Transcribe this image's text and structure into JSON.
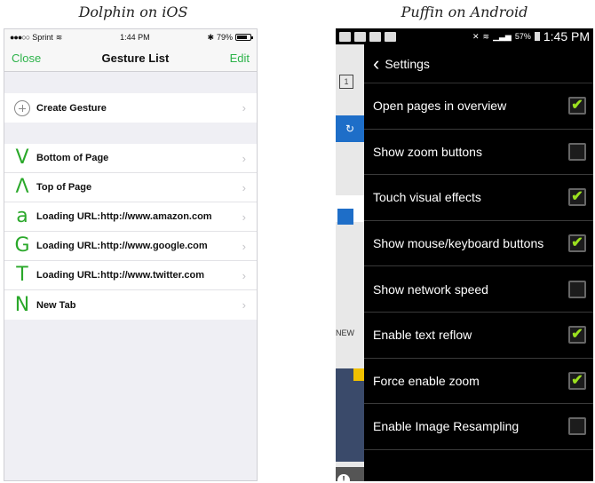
{
  "captions": {
    "left": "Dolphin on iOS",
    "right": "Puffin on Android"
  },
  "ios": {
    "status": {
      "carrier": "Sprint",
      "time": "1:44 PM",
      "battery": "79%",
      "battery_level": 0.79
    },
    "nav": {
      "left": "Close",
      "title": "Gesture List",
      "right": "Edit"
    },
    "create": {
      "label": "Create Gesture"
    },
    "gestures": [
      {
        "glyph": "V",
        "label": "Bottom of Page"
      },
      {
        "glyph": "Λ",
        "label": "Top of Page"
      },
      {
        "glyph": "a",
        "label": "Loading URL:http://www.amazon.com"
      },
      {
        "glyph": "G",
        "label": "Loading URL:http://www.google.com"
      },
      {
        "glyph": "T",
        "label": "Loading URL:http://www.twitter.com"
      },
      {
        "glyph": "N",
        "label": "New Tab"
      }
    ]
  },
  "android": {
    "status": {
      "battery": "57%",
      "time": "1:45 PM"
    },
    "background_tab": {
      "tab_count": "1",
      "partial_text": "NEW"
    },
    "header": {
      "title": "Settings"
    },
    "settings": [
      {
        "label": "Open pages in overview",
        "checked": true
      },
      {
        "label": "Show zoom buttons",
        "checked": false
      },
      {
        "label": "Touch visual effects",
        "checked": true
      },
      {
        "label": "Show mouse/keyboard buttons",
        "checked": true
      },
      {
        "label": "Show network speed",
        "checked": false
      },
      {
        "label": "Enable text reflow",
        "checked": true
      },
      {
        "label": "Force enable zoom",
        "checked": true
      },
      {
        "label": "Enable Image Resampling",
        "checked": false
      }
    ]
  }
}
